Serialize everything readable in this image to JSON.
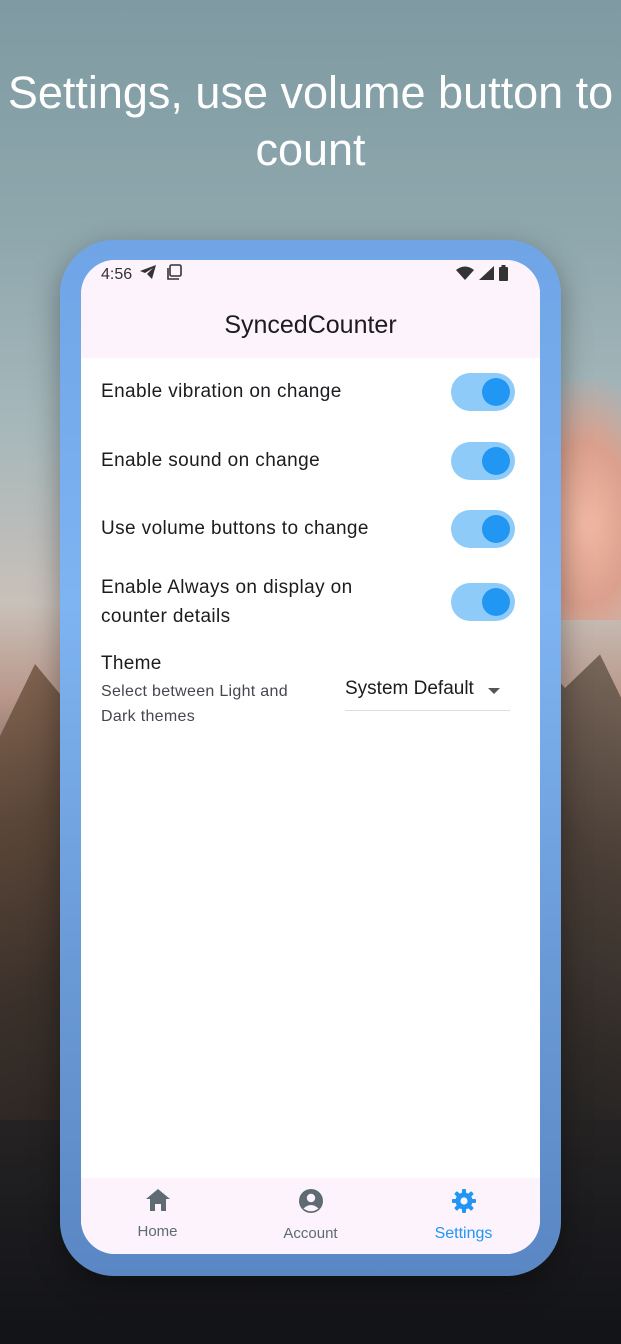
{
  "headline": "Settings, use volume button to count",
  "status_bar": {
    "time": "4:56",
    "left_icons": [
      "telegram-icon",
      "screenshot-icon"
    ],
    "right_icons": [
      "wifi-icon",
      "signal-icon",
      "battery-icon"
    ]
  },
  "app_bar": {
    "title": "SyncedCounter"
  },
  "settings": [
    {
      "label": "Enable vibration on change",
      "enabled": true
    },
    {
      "label": "Enable sound on change",
      "enabled": true
    },
    {
      "label": "Use volume buttons to change",
      "enabled": true
    },
    {
      "label": "Enable Always on display on counter details",
      "enabled": true
    }
  ],
  "theme": {
    "title": "Theme",
    "subtitle": "Select between Light and Dark themes",
    "selected": "System Default"
  },
  "bottom_nav": [
    {
      "label": "Home",
      "icon": "home-icon",
      "active": false
    },
    {
      "label": "Account",
      "icon": "account-icon",
      "active": false
    },
    {
      "label": "Settings",
      "icon": "settings-icon",
      "active": true
    }
  ],
  "colors": {
    "accent": "#2196f3",
    "switch_track": "#8fcbf9",
    "surface_tint": "#fcf3fc",
    "frame": "#7eb4f2"
  }
}
